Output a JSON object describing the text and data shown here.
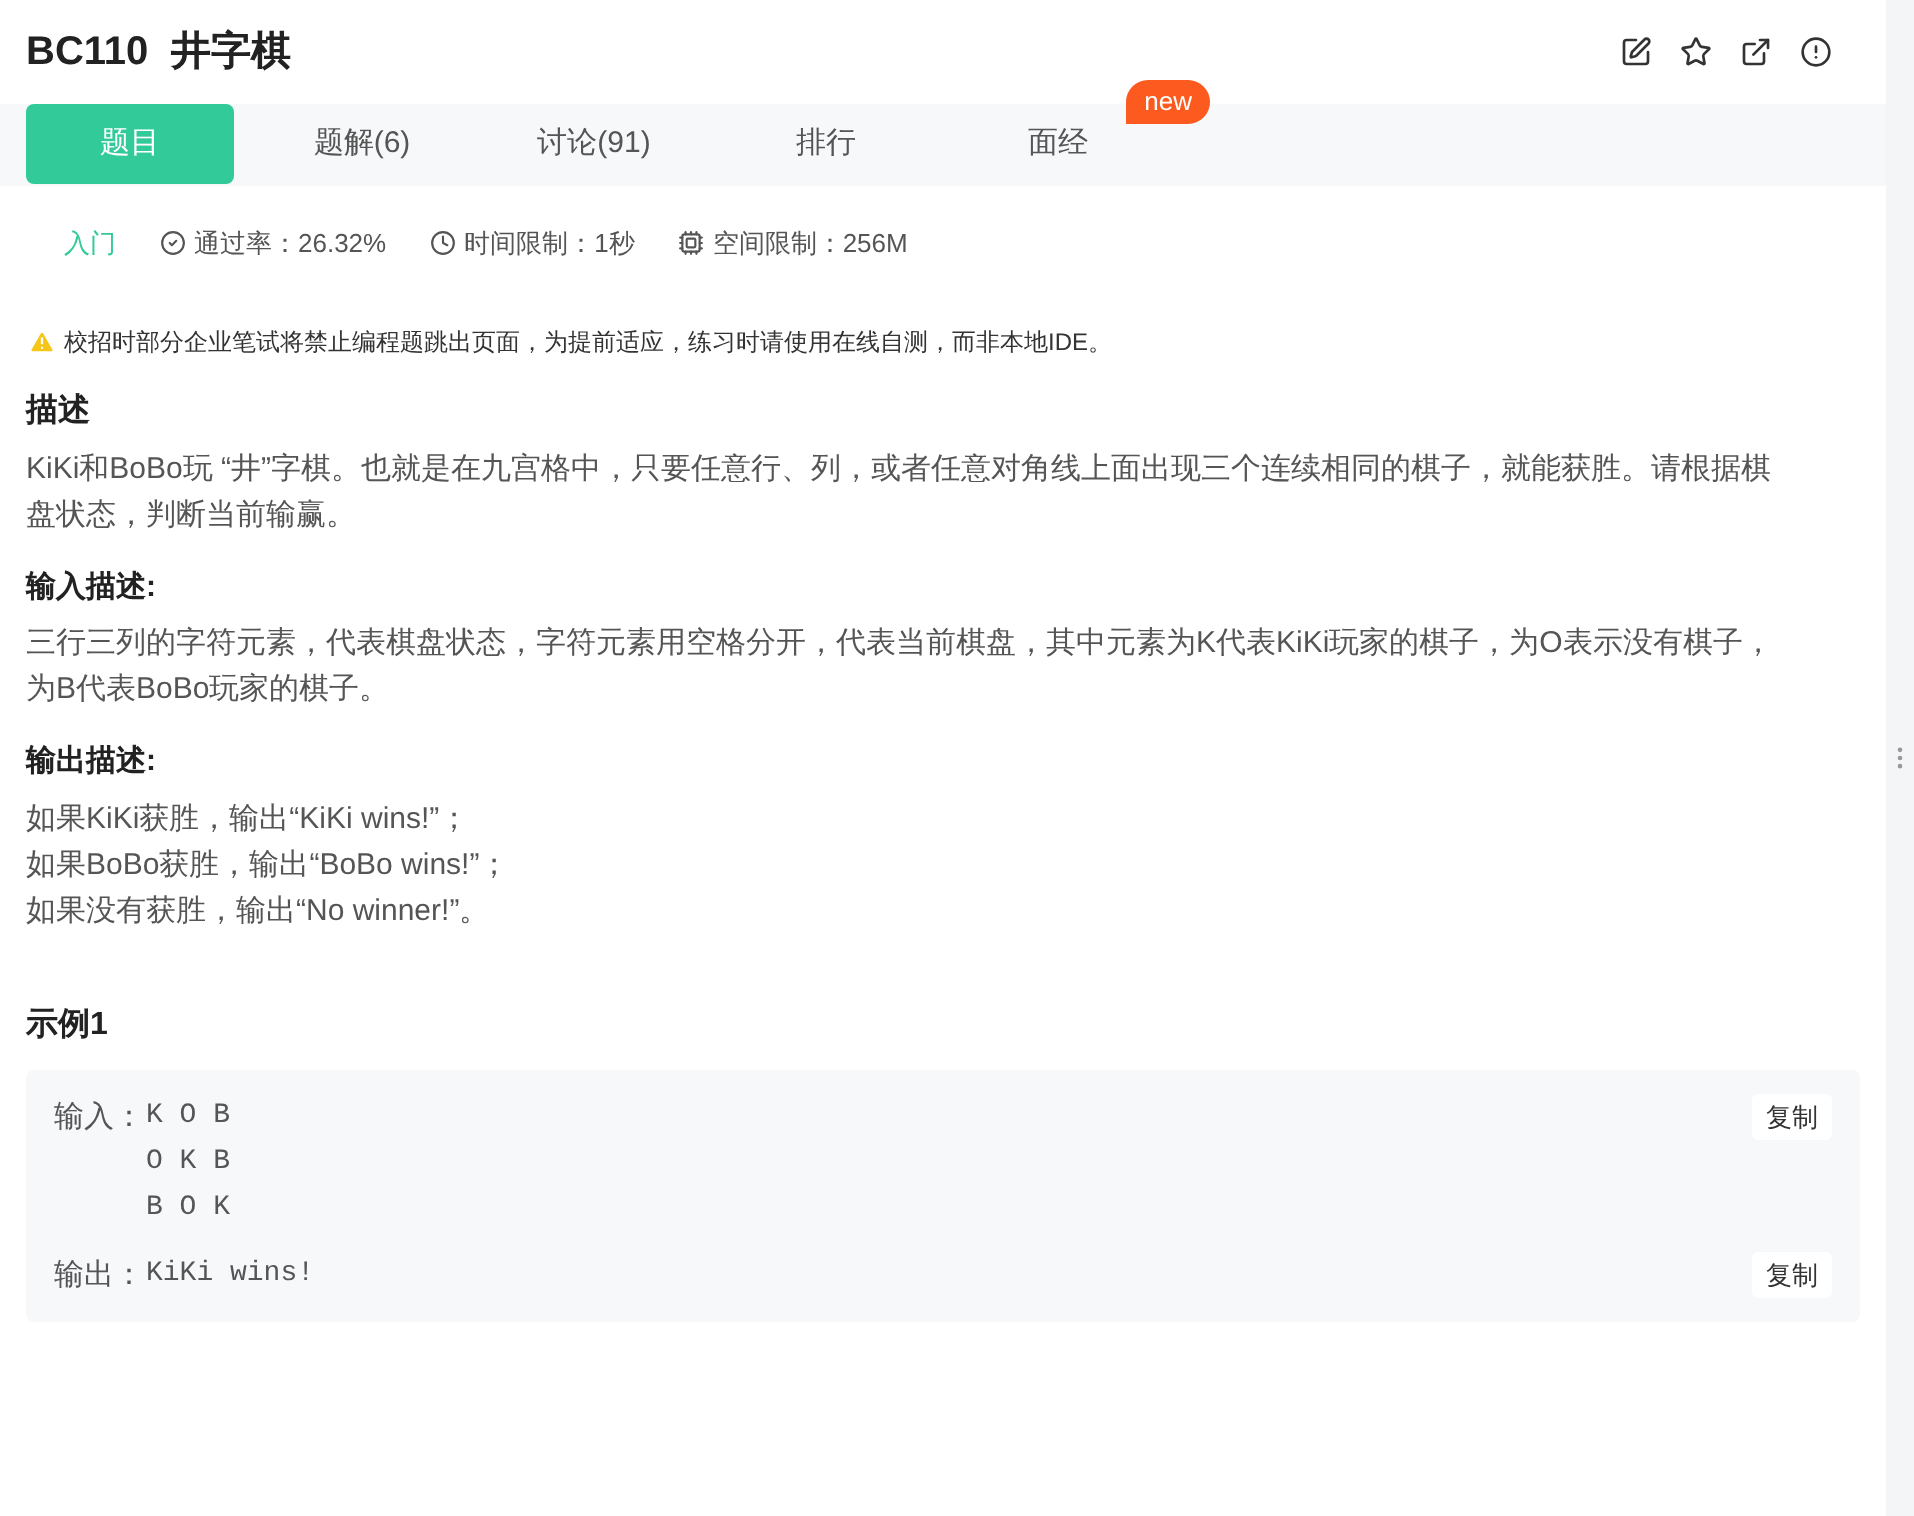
{
  "title": "BC110  井字棋",
  "tabs": [
    {
      "label": "题目",
      "selected": true
    },
    {
      "label": "题解(6)",
      "selected": false
    },
    {
      "label": "讨论(91)",
      "selected": false
    },
    {
      "label": "排行",
      "selected": false
    },
    {
      "label": "面经",
      "selected": false,
      "badge": "new"
    }
  ],
  "meta": {
    "difficulty": "入门",
    "pass_rate": "通过率：26.32%",
    "time_limit": "时间限制：1秒",
    "space_limit": "空间限制：256M"
  },
  "notice": "校招时部分企业笔试将禁止编程题跳出页面，为提前适应，练习时请使用在线自测，而非本地IDE。",
  "sections": [
    {
      "heading": "描述",
      "lines": [
        "KiKi和BoBo玩 “井”字棋。也就是在九宫格中，只要任意行、列，或者任意对角线上面出现三个连续相同的棋子，就能获胜。请根据棋盘状态，判断当前输赢。"
      ]
    },
    {
      "heading": "输入描述:",
      "lines": [
        "三行三列的字符元素，代表棋盘状态，字符元素用空格分开，代表当前棋盘，其中元素为K代表KiKi玩家的棋子，为O表示没有棋子，为B代表BoBo玩家的棋子。"
      ]
    },
    {
      "heading": "输出描述:",
      "lines": [
        "如果KiKi获胜，输出“KiKi wins!”；",
        "如果BoBo获胜，输出“BoBo wins!”；",
        "如果没有获胜，输出“No winner!”。"
      ]
    }
  ],
  "example": {
    "heading": "示例1",
    "input_label": "输入：",
    "input_lines": [
      "K O B",
      "O K B",
      "B O K"
    ],
    "output_label": "输出：",
    "output_lines": [
      "KiKi wins!"
    ],
    "copy_buttons": [
      "复制",
      "复制"
    ]
  }
}
